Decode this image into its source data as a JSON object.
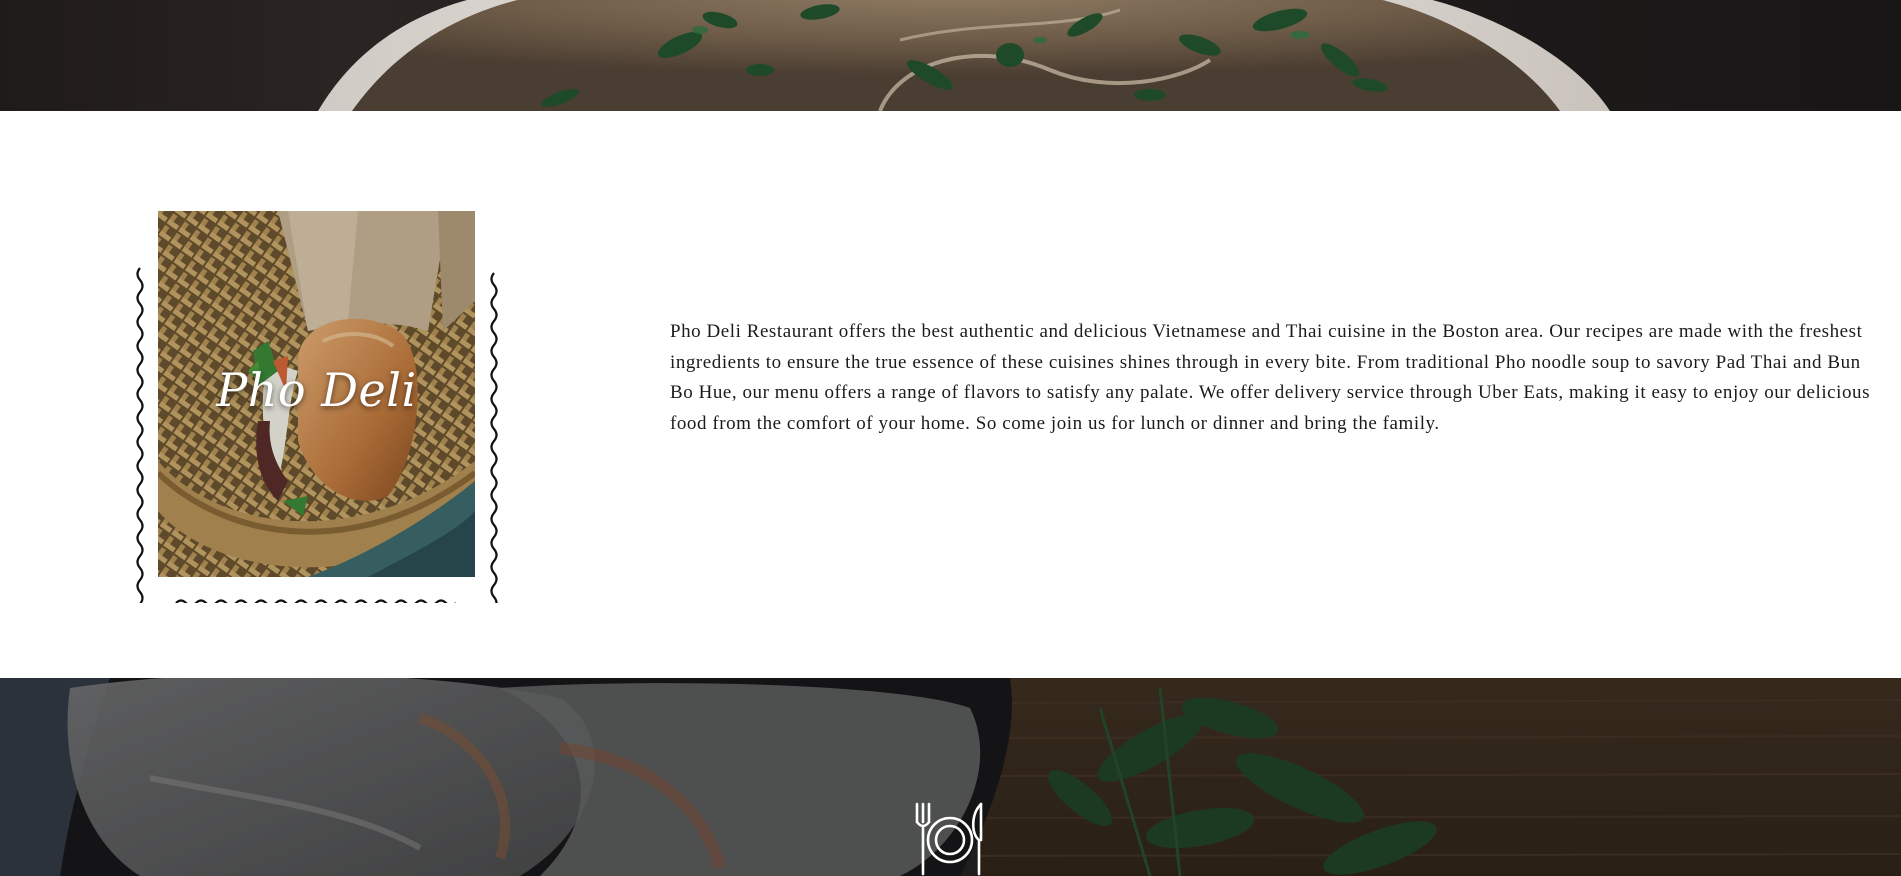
{
  "hero_top": {
    "image": "pho-bowl-photo"
  },
  "about": {
    "stamp_title": "Pho Deli",
    "stamp_image": "banh-mi-photo",
    "description": "Pho Deli Restaurant offers the best authentic and delicious Vietnamese and Thai cuisine in the Boston area. Our recipes are made with the freshest ingredients to ensure the true essence of these cuisines shines through in every bite. From traditional Pho noodle soup to savory Pad Thai and Bun Bo Hue, our menu offers a range of flavors to satisfy any palate. We offer delivery service through Uber Eats, making it easy to enjoy our delicious food from the comfort of your home. So come join us for lunch or dinner and bring the family."
  },
  "hero_bottom": {
    "image": "spring-rolls-photo",
    "icon": "dining-icon"
  }
}
